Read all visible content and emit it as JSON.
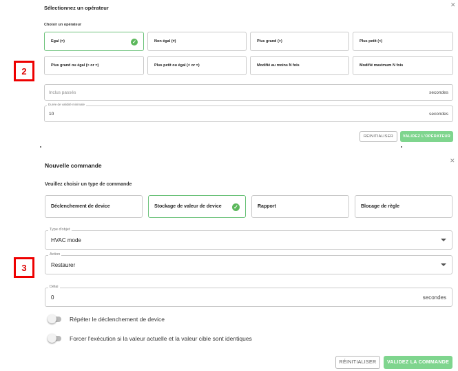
{
  "annotations": {
    "badge_top": "2",
    "badge_bottom": "3"
  },
  "operator_dialog": {
    "title": "Sélectionnez un opérateur",
    "close_icon": "close-icon",
    "subtitle": "Choisir un opérateur",
    "operators": [
      {
        "label": "Egal (=)",
        "selected": true
      },
      {
        "label": "Non égal (≠)",
        "selected": false
      },
      {
        "label": "Plus grand (>)",
        "selected": false
      },
      {
        "label": "Plus petit (<)",
        "selected": false
      },
      {
        "label": "Plus grand ou égal (> or =)",
        "selected": false
      },
      {
        "label": "Plus petit ou égal (< or =)",
        "selected": false
      },
      {
        "label": "Modifié au moins N fois",
        "selected": false
      },
      {
        "label": "Modifié maximum N fois",
        "selected": false
      }
    ],
    "inclus_passes": {
      "placeholder": "Inclus passés",
      "unit": "secondes"
    },
    "duree": {
      "label": "Durée de validité minimale",
      "value": "10",
      "unit": "secondes"
    },
    "reset_label": "RÉINITIALISER",
    "validate_label": "VALIDEZ L'OPÉRATEUR"
  },
  "command_dialog": {
    "title": "Nouvelle commande",
    "close_icon": "close-icon",
    "subtitle": "Veuillez choisir un type de commande",
    "types": [
      {
        "label": "Déclenchement de device",
        "selected": false
      },
      {
        "label": "Stockage de valeur de device",
        "selected": true
      },
      {
        "label": "Rapport",
        "selected": false
      },
      {
        "label": "Blocage de règle",
        "selected": false
      }
    ],
    "type_objet": {
      "label": "Type d'objet",
      "value": "HVAC mode"
    },
    "action": {
      "label": "Action",
      "value": "Restaurer"
    },
    "delai": {
      "label": "Délai",
      "value": "0",
      "unit": "secondes"
    },
    "toggles": [
      {
        "label": "Répéter le déclenchement de device",
        "on": false
      },
      {
        "label": "Forcer l'exécution si la valeur actuelle et la valeur cible sont identiques",
        "on": false
      }
    ],
    "reset_label": "RÉINITIALISER",
    "validate_label": "VALIDEZ LA COMMANDE"
  },
  "colors": {
    "accent_green": "#7fd58e",
    "selected_border": "#6cc27a",
    "badge_red": "#e00000"
  }
}
